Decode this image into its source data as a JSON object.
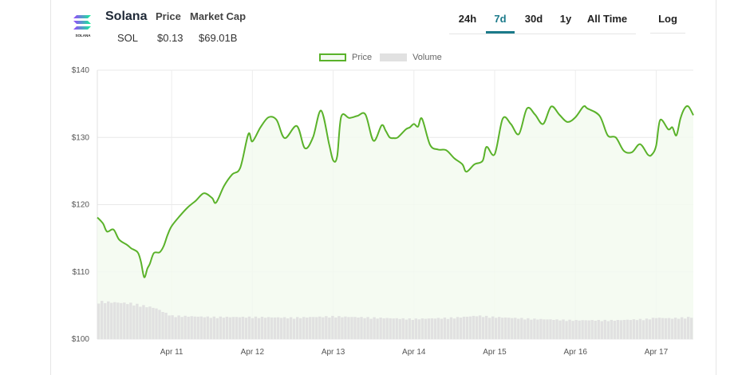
{
  "coin": {
    "name": "Solana",
    "symbol": "SOL",
    "logo_icon": "solana-logo-icon",
    "logo_text": "SOLANA",
    "price_label": "Price",
    "price_value": "$0.13",
    "market_cap_label": "Market Cap",
    "market_cap_value": "$69.01B"
  },
  "ranges": {
    "tabs": [
      "24h",
      "7d",
      "30d",
      "1y",
      "All Time"
    ],
    "active": "7d",
    "log_label": "Log"
  },
  "legend": {
    "price_label": "Price",
    "volume_label": "Volume"
  },
  "colors": {
    "price_line": "#5ab22a",
    "price_fill": "#f3faf0",
    "volume": "#e1e1e1",
    "active_tab": "#1b7a8a"
  },
  "chart_data": {
    "type": "line",
    "title": "",
    "xlabel": "",
    "ylabel": "",
    "x_tick_labels": [
      "Apr 11",
      "Apr 12",
      "Apr 13",
      "Apr 14",
      "Apr 15",
      "Apr 16",
      "Apr 17"
    ],
    "y_tick_labels": [
      "$100",
      "$110",
      "$120",
      "$130",
      "$140"
    ],
    "ylim": [
      100,
      140
    ],
    "xlim_days": [
      10.08,
      17.46
    ],
    "grid": true,
    "series": [
      {
        "name": "Price",
        "x": [
          10.08,
          10.15,
          10.2,
          10.28,
          10.35,
          10.45,
          10.5,
          10.58,
          10.62,
          10.66,
          10.7,
          10.73,
          10.78,
          10.85,
          10.9,
          10.95,
          11.0,
          11.1,
          11.2,
          11.3,
          11.4,
          11.5,
          11.55,
          11.65,
          11.75,
          11.85,
          11.95,
          12.0,
          12.1,
          12.2,
          12.3,
          12.4,
          12.55,
          12.65,
          12.75,
          12.85,
          12.95,
          13.0,
          13.05,
          13.1,
          13.2,
          13.3,
          13.4,
          13.5,
          13.6,
          13.65,
          13.7,
          13.75,
          13.8,
          13.9,
          13.95,
          14.0,
          14.05,
          14.1,
          14.2,
          14.3,
          14.4,
          14.5,
          14.6,
          14.65,
          14.75,
          14.85,
          14.9,
          15.0,
          15.1,
          15.2,
          15.3,
          15.4,
          15.5,
          15.6,
          15.7,
          15.8,
          15.9,
          16.0,
          16.1,
          16.15,
          16.3,
          16.4,
          16.5,
          16.6,
          16.7,
          16.8,
          16.9,
          16.95,
          17.0,
          17.05,
          17.15,
          17.2,
          17.25,
          17.3,
          17.35,
          17.4,
          17.46
        ],
        "y": [
          118.1,
          117.2,
          116.0,
          116.3,
          114.8,
          114.0,
          113.5,
          112.9,
          111.5,
          109.2,
          110.5,
          111.2,
          112.8,
          112.9,
          113.8,
          115.5,
          116.8,
          118.3,
          119.6,
          120.6,
          121.7,
          121.0,
          120.3,
          122.8,
          124.5,
          125.5,
          130.5,
          129.4,
          131.5,
          133.0,
          132.6,
          129.9,
          131.7,
          128.4,
          130.0,
          134.0,
          129.0,
          126.6,
          127.2,
          133.1,
          132.9,
          133.2,
          133.4,
          129.5,
          131.8,
          131.0,
          130.0,
          129.9,
          130.0,
          131.2,
          131.5,
          132.0,
          131.6,
          132.8,
          128.9,
          128.2,
          128.1,
          126.9,
          126.0,
          124.9,
          126.0,
          126.5,
          128.6,
          127.5,
          132.8,
          132.0,
          130.5,
          134.3,
          133.4,
          132.0,
          134.6,
          133.4,
          132.3,
          133.0,
          134.6,
          134.3,
          133.2,
          130.3,
          130.0,
          128.0,
          127.8,
          129.0,
          127.4,
          127.5,
          128.8,
          132.6,
          131.2,
          131.5,
          130.3,
          132.8,
          134.3,
          134.6,
          133.3
        ]
      },
      {
        "name": "Volume",
        "x": [
          10.1,
          10.5,
          10.8,
          11.0,
          11.5,
          12.0,
          12.5,
          13.0,
          13.5,
          14.0,
          14.5,
          14.8,
          15.0,
          15.5,
          16.0,
          16.5,
          16.9,
          17.0,
          17.2,
          17.46
        ],
        "relative_volume": [
          0.58,
          0.55,
          0.48,
          0.36,
          0.34,
          0.34,
          0.33,
          0.35,
          0.33,
          0.31,
          0.33,
          0.36,
          0.34,
          0.31,
          0.29,
          0.29,
          0.31,
          0.33,
          0.32,
          0.34
        ]
      }
    ]
  }
}
